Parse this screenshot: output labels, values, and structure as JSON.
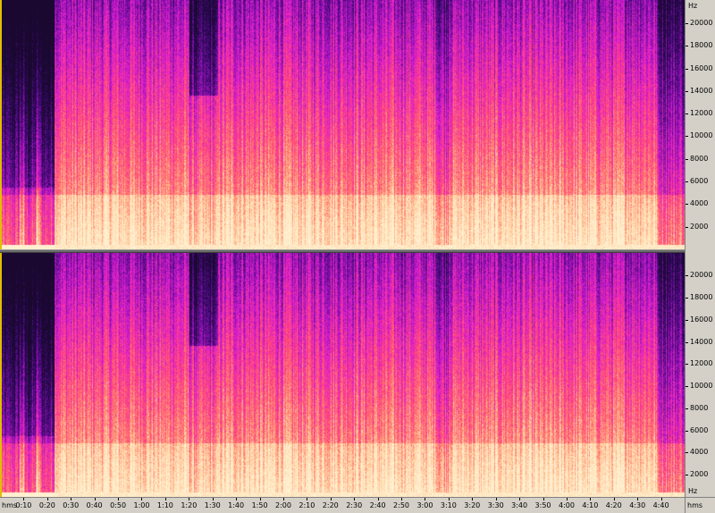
{
  "view": {
    "type": "spectrogram",
    "channels": [
      "top-channel",
      "bottom-channel"
    ],
    "colormap": [
      "#1a0830",
      "#3a0a6e",
      "#8a10b0",
      "#e020d0",
      "#ff4080",
      "#ff8070",
      "#ffd0a0",
      "#fff0d0"
    ]
  },
  "frequency_axis": {
    "unit": "Hz",
    "labels": [
      "20000",
      "18000",
      "16000",
      "14000",
      "12000",
      "10000",
      "8000",
      "6000",
      "4000",
      "2000"
    ],
    "values": [
      20000,
      18000,
      16000,
      14000,
      12000,
      10000,
      8000,
      6000,
      4000,
      2000
    ],
    "max": 22050
  },
  "time_axis": {
    "unit_left": "hms",
    "unit_right": "hms",
    "labels": [
      "0:10",
      "0:20",
      "0:30",
      "0:40",
      "0:50",
      "1:00",
      "1:10",
      "1:20",
      "1:30",
      "1:40",
      "1:50",
      "2:00",
      "2:10",
      "2:20",
      "2:30",
      "2:40",
      "2:50",
      "3:00",
      "3:10",
      "3:20",
      "3:30",
      "3:40",
      "3:50",
      "4:00",
      "4:10",
      "4:20",
      "4:30",
      "4:40"
    ],
    "seconds": [
      10,
      20,
      30,
      40,
      50,
      60,
      70,
      80,
      90,
      100,
      110,
      120,
      130,
      140,
      150,
      160,
      170,
      180,
      190,
      200,
      210,
      220,
      230,
      240,
      250,
      260,
      270,
      280
    ],
    "total_seconds": 290
  }
}
